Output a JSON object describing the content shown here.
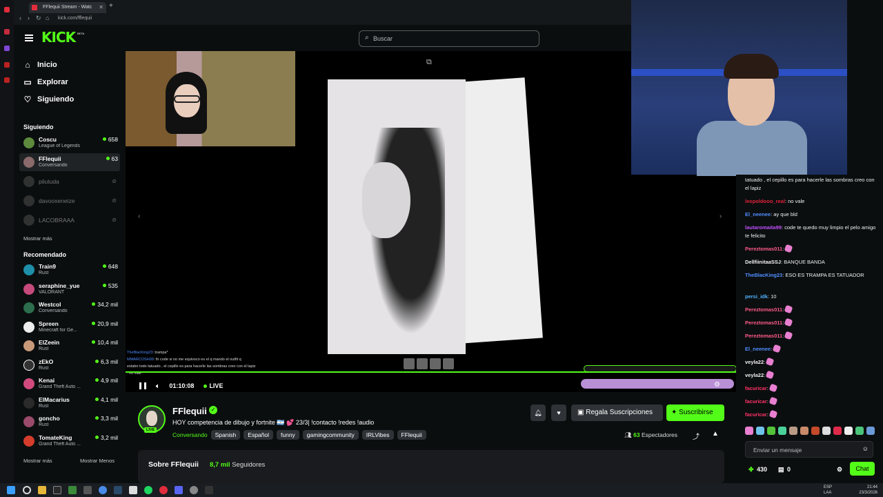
{
  "browser": {
    "tab_title": "FFlequii Stream - Watc",
    "url": "kick.com/fflequii"
  },
  "brand": {
    "logo": "KICK",
    "beta": "BETA",
    "accent": "#53fc18"
  },
  "search": {
    "placeholder": "Buscar"
  },
  "nav": [
    {
      "label": "Inicio",
      "icon": "home-icon"
    },
    {
      "label": "Explorar",
      "icon": "compass-icon"
    },
    {
      "label": "Siguiendo",
      "icon": "heart-icon"
    }
  ],
  "following": {
    "title": "Siguiendo",
    "channels": [
      {
        "name": "Coscu",
        "category": "League of Legends",
        "viewers": "658",
        "live": true
      },
      {
        "name": "FFlequii",
        "category": "Conversando",
        "viewers": "63",
        "live": true
      },
      {
        "name": "pilutuda",
        "live": false
      },
      {
        "name": "davooxeneize",
        "live": false
      },
      {
        "name": "LACOBRAAA",
        "live": false
      }
    ],
    "more": "Mostrar más"
  },
  "recommended": {
    "title": "Recomendado",
    "channels": [
      {
        "name": "Train9",
        "category": "Rust",
        "viewers": "648"
      },
      {
        "name": "seraphine_yue",
        "category": "VALORANT",
        "viewers": "535"
      },
      {
        "name": "Westcol",
        "category": "Conversando",
        "viewers": "34,2 mil"
      },
      {
        "name": "Spreen",
        "category": "Minecraft for Ge...",
        "viewers": "20,9 mil"
      },
      {
        "name": "ElZeein",
        "category": "Rust",
        "viewers": "10,4 mil"
      },
      {
        "name": "zEkO",
        "category": "Rust",
        "viewers": "6,3 mil"
      },
      {
        "name": "Kenai",
        "category": "Grand Theft Auto ...",
        "viewers": "4,9 mil"
      },
      {
        "name": "ElMacarius",
        "category": "Rust",
        "viewers": "4,1 mil"
      },
      {
        "name": "goncho",
        "category": "Rust",
        "viewers": "3,3 mil"
      },
      {
        "name": "TomateKing",
        "category": "Grand Theft Auto ...",
        "viewers": "3,2 mil"
      }
    ],
    "more": "Mostrar más",
    "less": "Mostrar Menos"
  },
  "player": {
    "time": "01:10:08",
    "live": "LIVE",
    "overlay_chat": [
      {
        "user": "TheBlacKing23",
        "text": ": trampa*"
      },
      {
        "user": "MMARCOSH99",
        "text": ": fn code si no me equivoco es el q mando el outfit q"
      },
      {
        "user": "",
        "text": "estabo todo tatuado , el cepillo es para hacerle las sombras creo con el lapiz"
      },
      {
        "user": "",
        "text": ": no vale"
      }
    ]
  },
  "stream": {
    "streamer": "FFlequii",
    "live_badge": "LIVE",
    "title": "HOY competencia de dibujo y fortnite 🇦🇷 💕 23/3| !contacto !redes !audio",
    "category": "Conversando",
    "tags": [
      "Spanish",
      "Español",
      "funny",
      "gamingcommunity",
      "IRLVibes",
      "FFlequii"
    ],
    "viewers_count": "63",
    "viewers_label": "Espectadores",
    "gift_label": "Regala Suscripciones",
    "subscribe_label": "Suscribirse"
  },
  "about": {
    "title": "Sobre FFlequii",
    "followers": "8,7 mil",
    "followers_label": "Seguidores"
  },
  "chat": {
    "messages": [
      {
        "user": "",
        "text": "tatuado , el cepillo es para hacerle las sombras creo con el lapiz",
        "color": "#efefef"
      },
      {
        "user": "leopoldooo_real",
        "text": ": no vale",
        "color": "#e0223b"
      },
      {
        "user": "El_neenee",
        "text": ": ay que bld",
        "color": "#4f8dff"
      },
      {
        "user": "lautaromaita99",
        "text": ": code te quedo muy limpio el pelo amigo te felicito",
        "color": "#c04fff"
      },
      {
        "user": "Pereztomas011",
        "text": ":",
        "color": "#ff5a8a",
        "emote": true
      },
      {
        "user": "DellfiinitaaSSJ",
        "text": ": BANQUE BANDA",
        "color": "#efefef"
      },
      {
        "user": "TheBlacKing23",
        "text": ": ESO ES TRAMPA ES TATUADOR",
        "color": "#4f8dff"
      },
      {
        "user": "persi_idk",
        "text": ": 10",
        "color": "#4fb3ff"
      },
      {
        "user": "Pereztomas011",
        "text": ":",
        "color": "#ff5a8a",
        "emote": true
      },
      {
        "user": "Pereztomas011",
        "text": ":",
        "color": "#ff5a8a",
        "emote": true
      },
      {
        "user": "Pereztomas011",
        "text": ":",
        "color": "#ff5a8a",
        "emote": true
      },
      {
        "user": "El_neenee",
        "text": ":",
        "color": "#4f8dff",
        "emote": true
      },
      {
        "user": "veyla22",
        "text": ":",
        "color": "#efefef",
        "emote": true
      },
      {
        "user": "veyla22",
        "text": ":",
        "color": "#efefef",
        "emote": true
      },
      {
        "user": "facuricar",
        "text": ":",
        "color": "#ff3366",
        "emote": true
      },
      {
        "user": "facuricar",
        "text": ":",
        "color": "#ff3366",
        "emote": true
      },
      {
        "user": "facuricar",
        "text": ":",
        "color": "#ff3366",
        "emote": true
      }
    ],
    "input_placeholder": "Enviar un mensaje",
    "points": "430",
    "gifts": "0",
    "send_label": "Chat"
  },
  "taskbar": {
    "lang1": "ESP",
    "lang2": "LAA",
    "time": "21:44",
    "date": "23/3/2026"
  }
}
